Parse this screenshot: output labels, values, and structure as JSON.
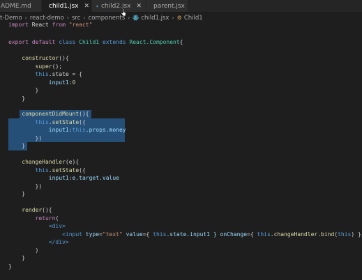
{
  "tabs": [
    {
      "label": "ADME.md",
      "active": false,
      "has_close": false
    },
    {
      "label": "child1.jsx",
      "active": true,
      "has_close": true
    },
    {
      "label": "child2.jsx",
      "active": false,
      "has_close": true
    },
    {
      "label": "parent.jsx",
      "active": false,
      "has_close": false
    }
  ],
  "breadcrumb": {
    "items": [
      "t-Demo",
      "react-demo",
      "src",
      "components",
      "child1.jsx",
      "Child1"
    ]
  },
  "colors": {
    "editor_bg": "#1e1e1e",
    "selection": "#264f78",
    "react_icon": "#61dafb"
  },
  "code": {
    "l1": {
      "kw": "import",
      "name": " React ",
      "from": "from",
      "str": " \"react\""
    },
    "l3": {
      "export": "export",
      "default": " default ",
      "class": "class",
      "name": " Child1 ",
      "extends": "extends",
      "base": " React.Component",
      "brace": "{"
    },
    "l5": {
      "indent": "    ",
      "fn": "constructor",
      "rest": "(){"
    },
    "l6": {
      "indent": "        ",
      "fn": "super",
      "rest": "();"
    },
    "l7": {
      "indent": "        ",
      "this": "this",
      "rest": ".state = {"
    },
    "l8": {
      "indent": "            ",
      "prop": "input1",
      "colon": ":",
      "num": "0"
    },
    "l9": {
      "indent": "        ",
      "rest": "}"
    },
    "l10": {
      "indent": "    ",
      "rest": "}"
    },
    "l12": {
      "indent": "    ",
      "fn": "componentDidMount",
      "rest": "(){"
    },
    "l13": {
      "indent": "        ",
      "this": "this",
      "dot": ".",
      "fn": "setState",
      "rest": "({"
    },
    "l14": {
      "indent": "            ",
      "prop": "input1",
      "colon": ":",
      "this": "this",
      "rest": ".props.money"
    },
    "l15": {
      "indent": "        ",
      "rest": "})"
    },
    "l16": {
      "indent": "    ",
      "rest": "}"
    },
    "l18": {
      "indent": "    ",
      "fn": "changeHandler",
      "rest": "(e){"
    },
    "l19": {
      "indent": "        ",
      "this": "this",
      "dot": ".",
      "fn": "setState",
      "rest": "({"
    },
    "l20": {
      "indent": "            ",
      "prop": "input1",
      "colon": ":",
      "rest": "e.target.value"
    },
    "l21": {
      "indent": "        ",
      "rest": "})"
    },
    "l22": {
      "indent": "    ",
      "rest": "}"
    },
    "l24": {
      "indent": "    ",
      "fn": "render",
      "rest": "(){"
    },
    "l25": {
      "indent": "        ",
      "kw": "return",
      "rest": "("
    },
    "l26": {
      "indent": "            ",
      "tag": "<div>"
    },
    "l27": {
      "indent": "                ",
      "tag_open": "<input",
      "attr1": " type",
      "eq1": "=",
      "str1": "\"text\"",
      "attr2": " value",
      "eq2": "=",
      "expr1": "{ ",
      "this1": "this",
      "rest1": ".state.input1 } ",
      "attr3": "onChange",
      "eq3": "=",
      "expr2": "{ ",
      "this2": "this",
      "rest2": ".changeHandler.bind(",
      "this3": "this",
      "rest3": ") }",
      "tag_close": "/>"
    },
    "l28": {
      "indent": "            ",
      "tag": "</div>"
    },
    "l29": {
      "indent": "        ",
      "rest": ")"
    },
    "l30": {
      "indent": "    ",
      "rest": "}"
    },
    "l31": {
      "indent": "",
      "rest": "}"
    }
  }
}
